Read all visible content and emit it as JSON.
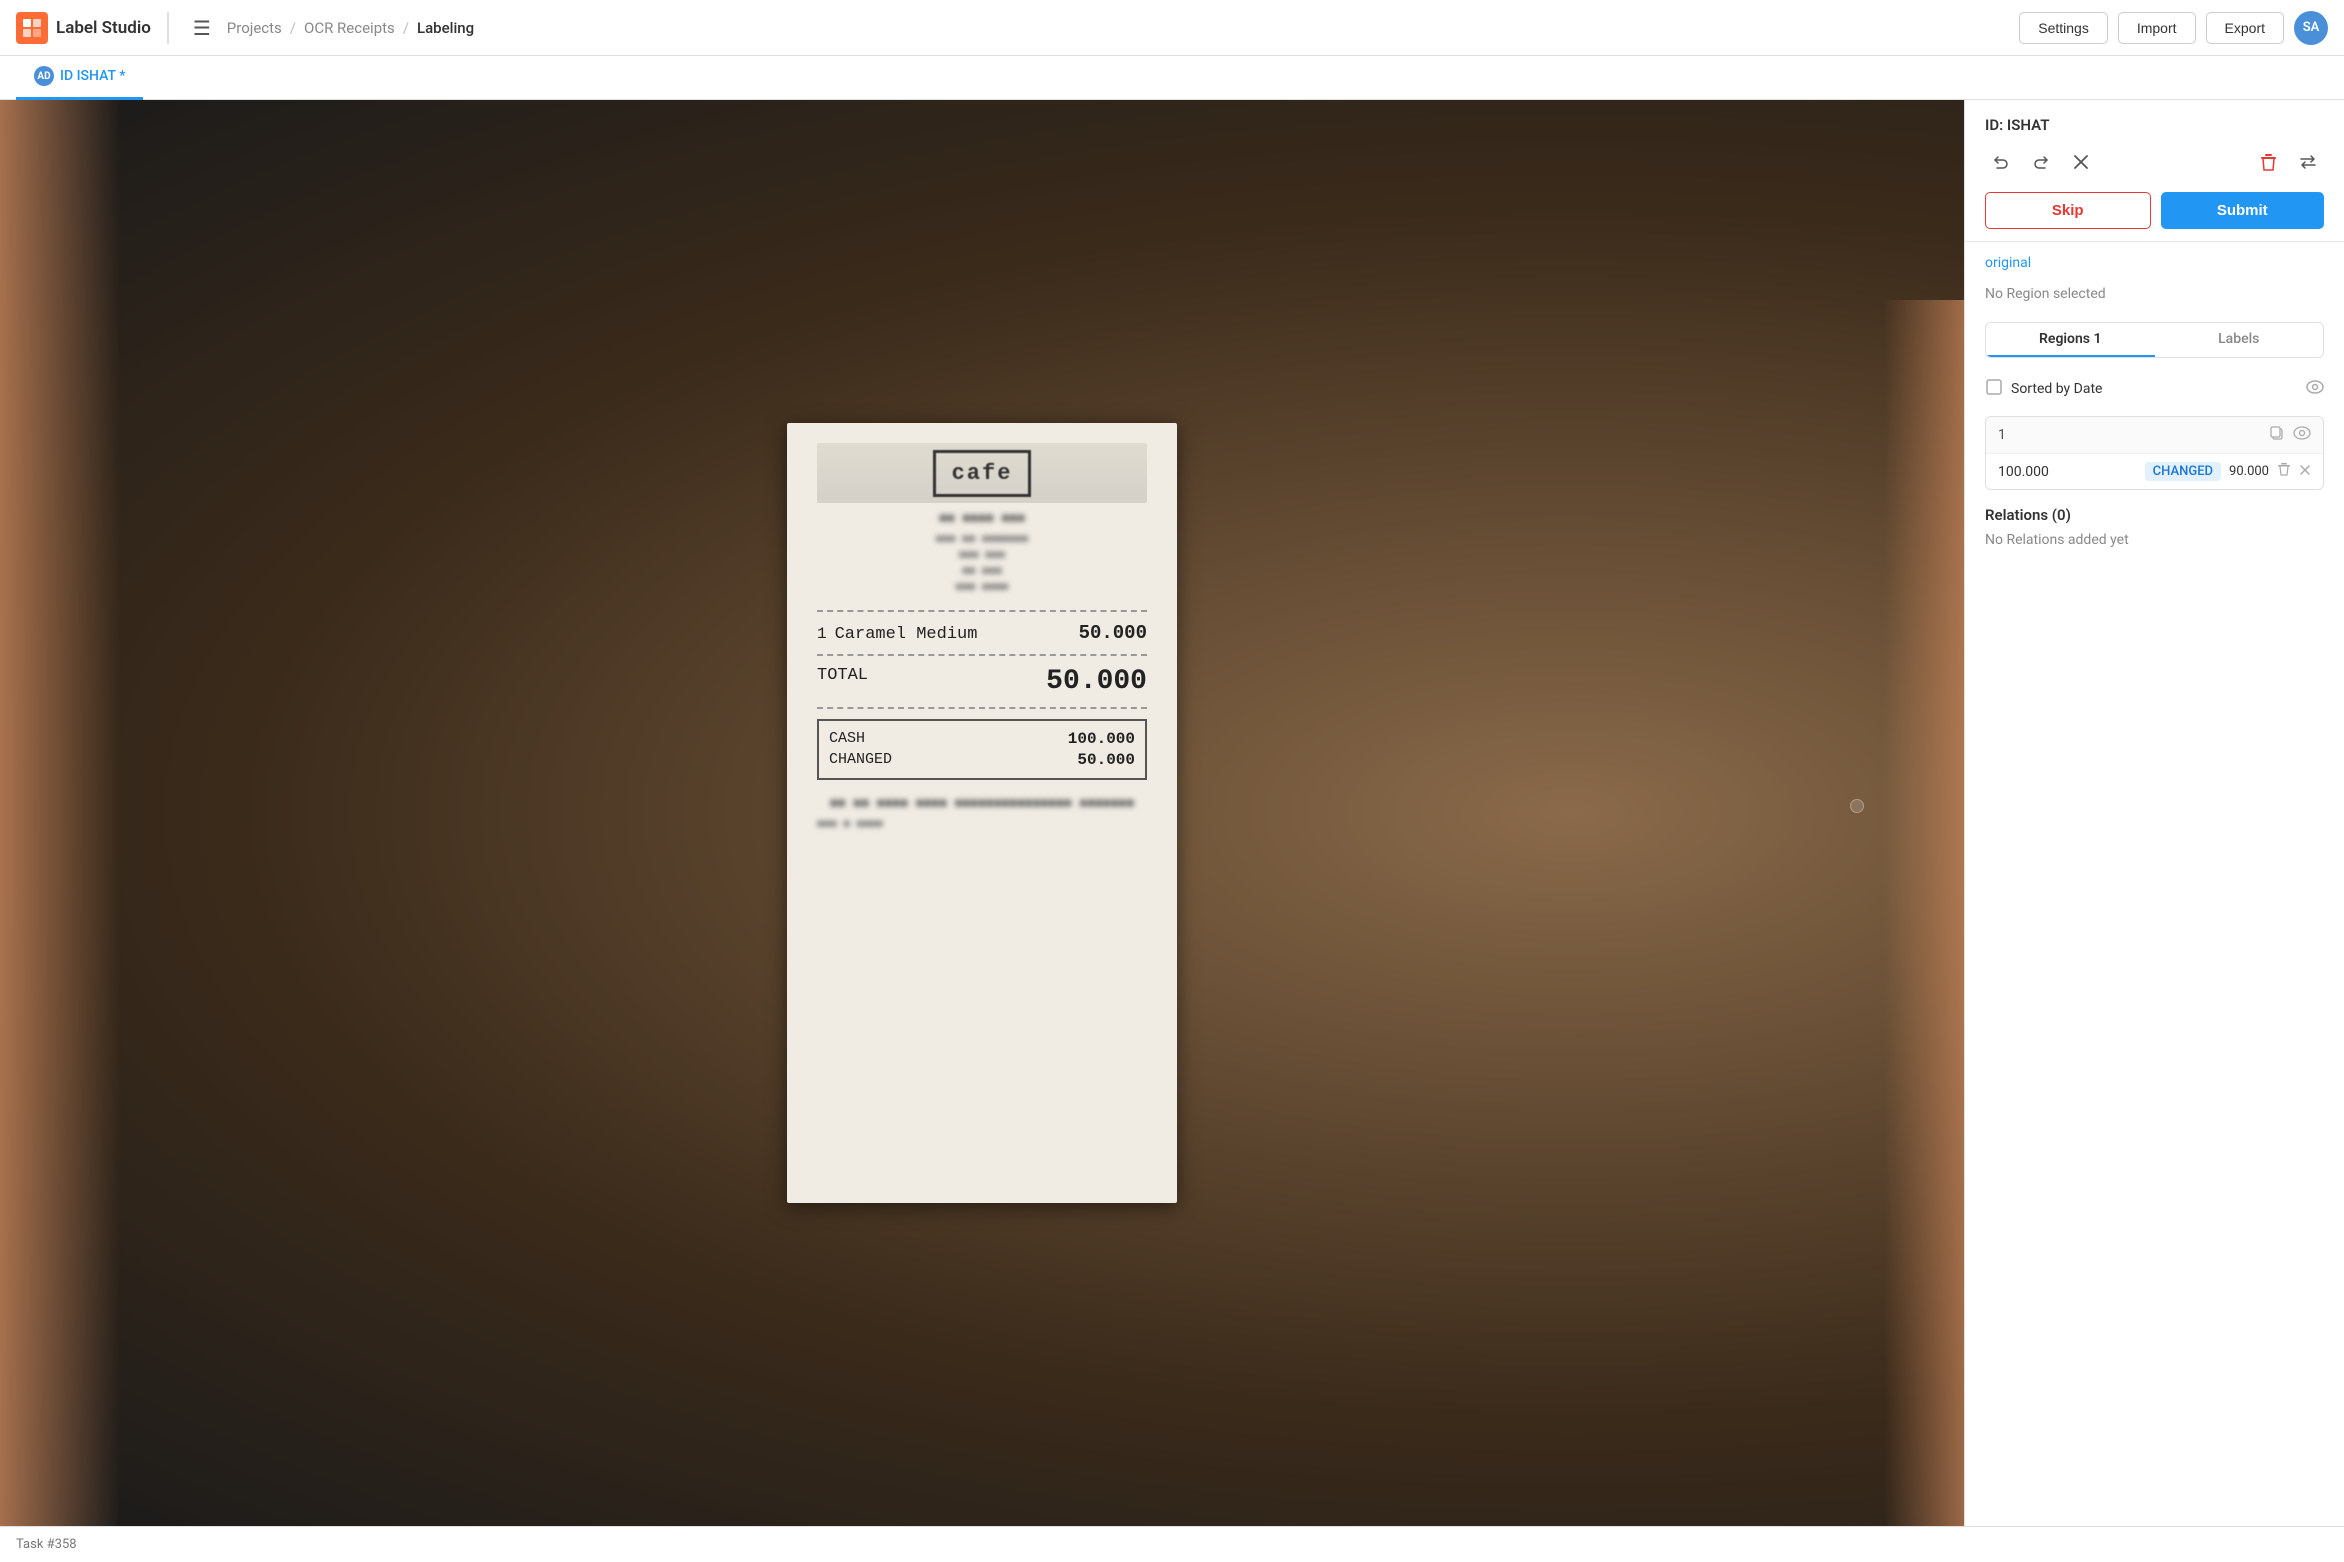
{
  "app": {
    "logo_text": "Label Studio",
    "hamburger": "☰"
  },
  "breadcrumb": {
    "projects": "Projects",
    "sep1": "/",
    "project_name": "OCR Receipts",
    "sep2": "/",
    "current": "Labeling"
  },
  "nav_buttons": {
    "settings": "Settings",
    "import": "Import",
    "export": "Export",
    "avatar": "SA"
  },
  "subnav": {
    "tab_label": "ID ISHAT *"
  },
  "right_panel": {
    "task_id": "ID: ISHAT",
    "toolbar": {
      "undo": "↺",
      "redo": "↻",
      "close": "✕",
      "delete": "🗑",
      "swap": "⇌"
    },
    "skip_label": "Skip",
    "submit_label": "Submit",
    "original_label": "original",
    "no_region": "No Region selected",
    "regions_tab": "Regions 1",
    "labels_tab": "Labels",
    "sorted_by_date": "Sorted by Date",
    "region_number": "1",
    "region_value": "100.000",
    "region_tag": "CHANGED",
    "region_tag2": "90.000",
    "relations_title": "Relations (0)",
    "no_relations": "No Relations added yet"
  },
  "receipt": {
    "cafe_text": "cafe",
    "item_num": "1",
    "item_name": "Caramel Medium",
    "item_price": "50.000",
    "total_label": "TOTAL",
    "total_price": "50.000",
    "cash_label": "CASH",
    "cash_value": "100.000",
    "changed_label": "CHANGED",
    "changed_value": "50.000"
  },
  "bottom_bar": {
    "task_label": "Task #358"
  }
}
